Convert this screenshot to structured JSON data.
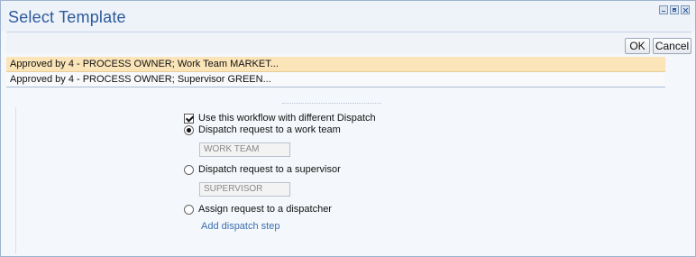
{
  "dialog": {
    "title": "Select Template",
    "ok_label": "OK",
    "cancel_label": "Cancel"
  },
  "templates": [
    {
      "label": "Approved by 4 - PROCESS OWNER; Work Team MARKET...",
      "selected": true
    },
    {
      "label": "Approved by 4 - PROCESS OWNER; Supervisor GREEN...",
      "selected": false
    }
  ],
  "dispatch": {
    "use_workflow_label": "Use this workflow with different Dispatch",
    "use_workflow_checked": true,
    "options": [
      {
        "label": "Dispatch request to a work team",
        "checked": true,
        "field_value": "WORK TEAM"
      },
      {
        "label": "Dispatch request to a supervisor",
        "checked": false,
        "field_value": "SUPERVISOR"
      },
      {
        "label": "Assign request to a dispatcher",
        "checked": false
      }
    ],
    "add_step_label": "Add dispatch step"
  },
  "colors": {
    "title": "#2d5a9a",
    "selected_row": "#fae4b8",
    "link": "#3a6fb0"
  }
}
